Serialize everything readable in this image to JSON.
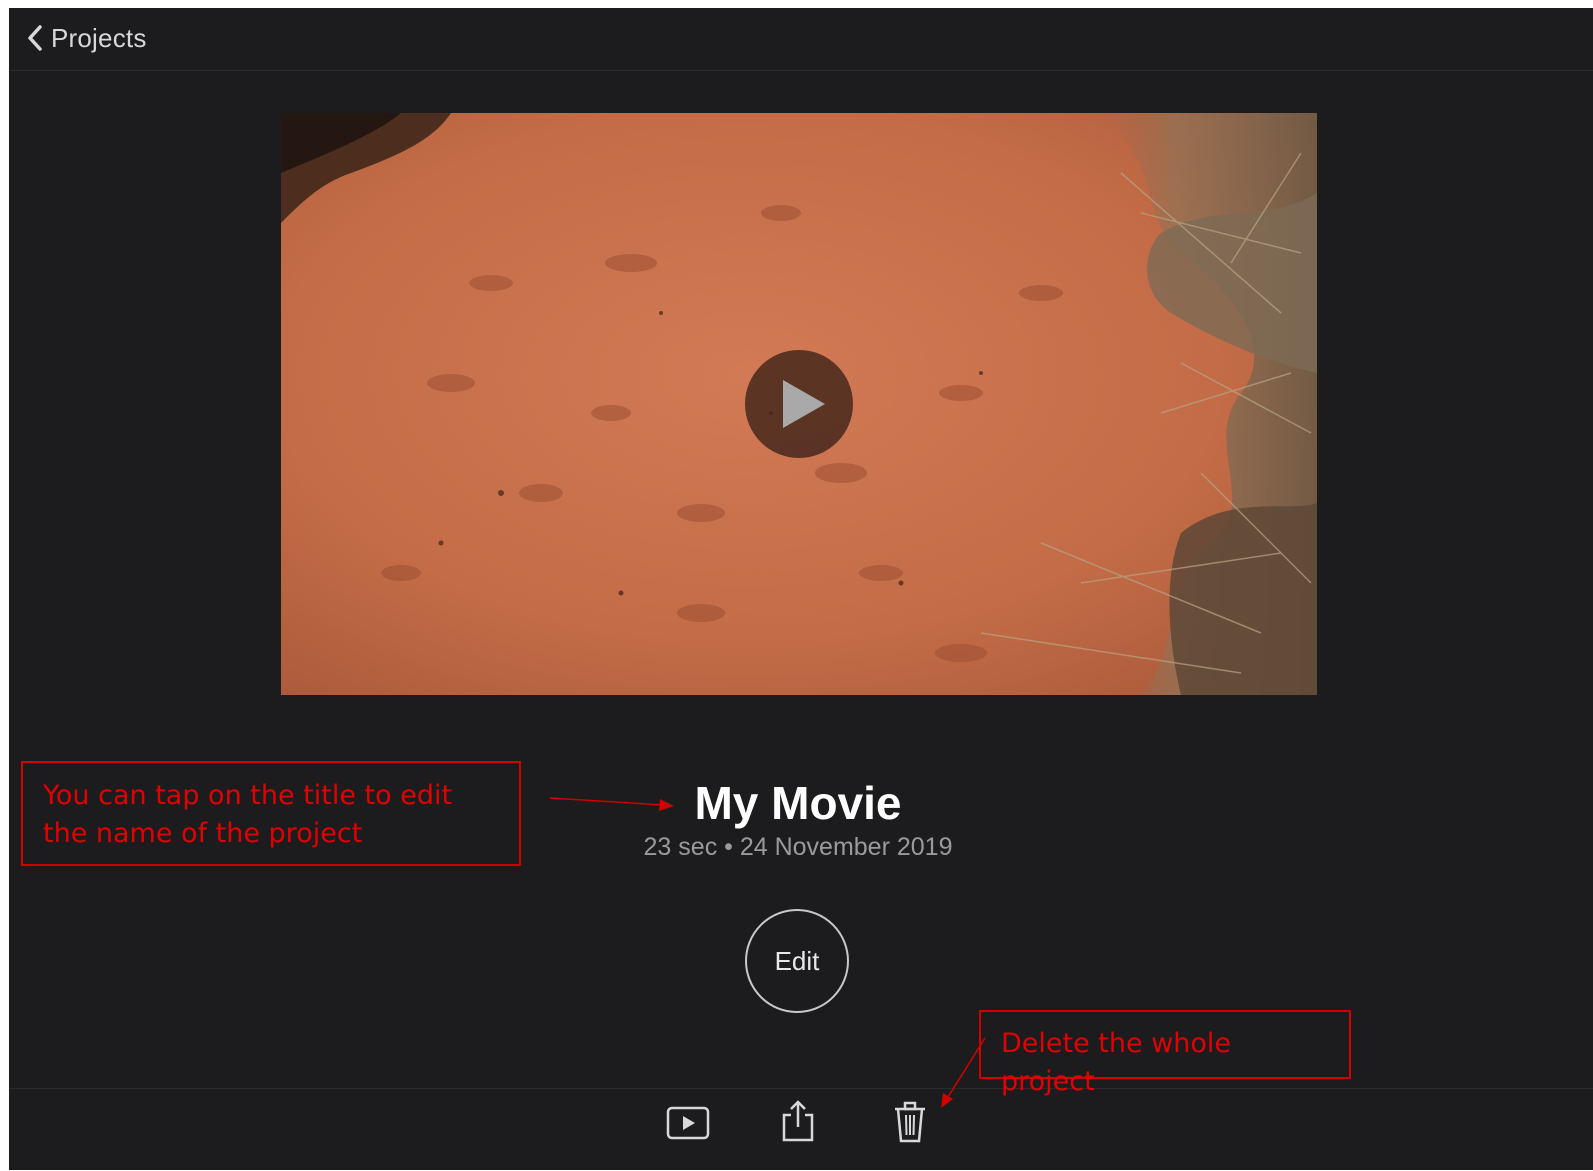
{
  "navbar": {
    "back_label": "Projects",
    "back_icon": "chevron-left-icon"
  },
  "preview": {
    "play_icon": "play-icon",
    "thumbnail": "red desert sand with animal tracks and dry grass"
  },
  "project": {
    "title": "My Movie",
    "meta": "23 sec • 24 November 2019"
  },
  "actions": {
    "edit_label": "Edit"
  },
  "toolbar": {
    "icons": [
      "play-movie-icon",
      "share-icon",
      "trash-icon"
    ]
  },
  "annotations": {
    "title_note": "You can tap on the title to edit the name of the project",
    "delete_note": "Delete the whole project",
    "color": "#e00000"
  },
  "colors": {
    "background": "#1c1c1e",
    "sand": "#c8704e"
  }
}
